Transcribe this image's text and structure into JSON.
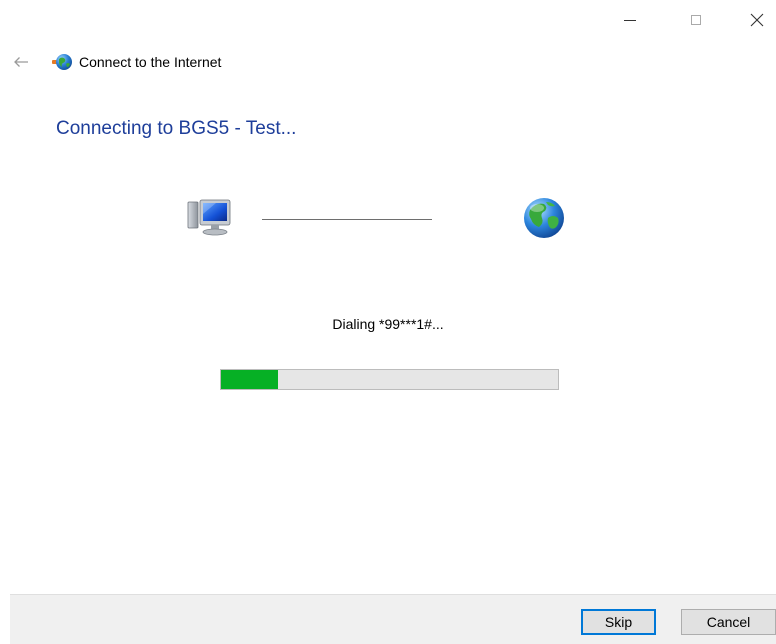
{
  "window": {
    "title": "Connect to the Internet",
    "controls": [
      "minimize-icon",
      "maximize-icon",
      "close-icon"
    ]
  },
  "main": {
    "heading": "Connecting to BGS5 - Test...",
    "status": "Dialing *99***1#...",
    "progress": 0.17,
    "icons": [
      "computer-icon",
      "globe-icon"
    ]
  },
  "footer": {
    "skip_label": "Skip",
    "cancel_label": "Cancel"
  },
  "colors": {
    "heading": "#1e3e9a",
    "progress_fill": "#06b025",
    "progress_track": "#e6e6e6",
    "default_button_border": "#0078d7",
    "footer_bg": "#f0f0f0"
  }
}
